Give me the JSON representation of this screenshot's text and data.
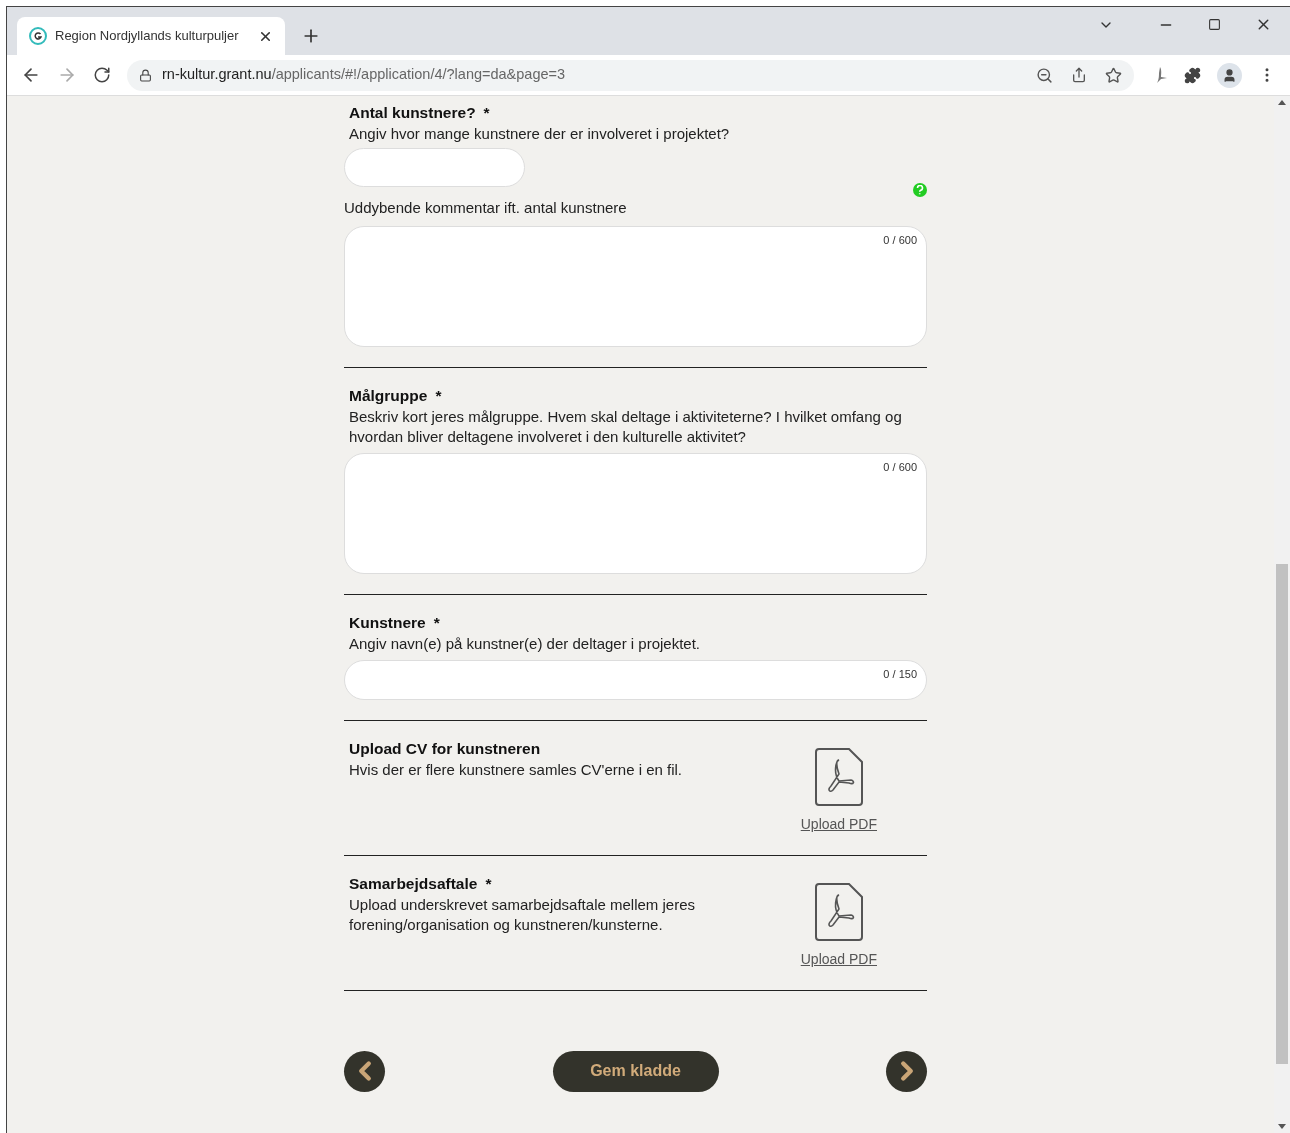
{
  "browser": {
    "tab": {
      "title": "Region Nordjyllands kulturpuljer",
      "selected": true
    },
    "address": {
      "host": "rn-kultur.grant.nu",
      "path": "/applicants/#!/application/4/?lang=da&page=3"
    }
  },
  "sections": [
    {
      "title": "Antal kunstnere?",
      "required": true,
      "description": "Angiv hvor mange kunstnere der er involveret i projektet?",
      "fields": [
        {
          "kind": "short"
        },
        {
          "kind": "help"
        },
        {
          "kind": "label",
          "text": "Uddybende kommentar ift. antal kunstnere"
        },
        {
          "kind": "textarea",
          "counter": "0 / 600"
        }
      ]
    },
    {
      "title": "Målgruppe",
      "required": true,
      "description": "Beskriv kort jeres målgruppe. Hvem skal deltage i aktiviteterne? I hvilket omfang og hvordan bliver deltagene involveret i den kulturelle aktivitet?",
      "fields": [
        {
          "kind": "textarea",
          "counter": "0 / 600"
        }
      ]
    },
    {
      "title": "Kunstnere",
      "required": true,
      "description": "Angiv navn(e) på kunstner(e) der deltager i projektet.",
      "fields": [
        {
          "kind": "line",
          "counter": "0 / 150"
        }
      ]
    },
    {
      "title": "Upload CV for kunstneren",
      "required": false,
      "description": "Hvis der er flere kunstnere samles CV'erne i en fil.",
      "fields": [
        {
          "kind": "upload",
          "link": "Upload PDF"
        }
      ]
    },
    {
      "title": "Samarbejdsaftale",
      "required": true,
      "description": "Upload underskrevet samarbejdsaftale mellem jeres forening/organisation og kunstneren/kunsterne.",
      "fields": [
        {
          "kind": "upload",
          "link": "Upload PDF"
        }
      ]
    }
  ],
  "required_mark": "*",
  "footer": {
    "save_button": "Gem kladde"
  }
}
